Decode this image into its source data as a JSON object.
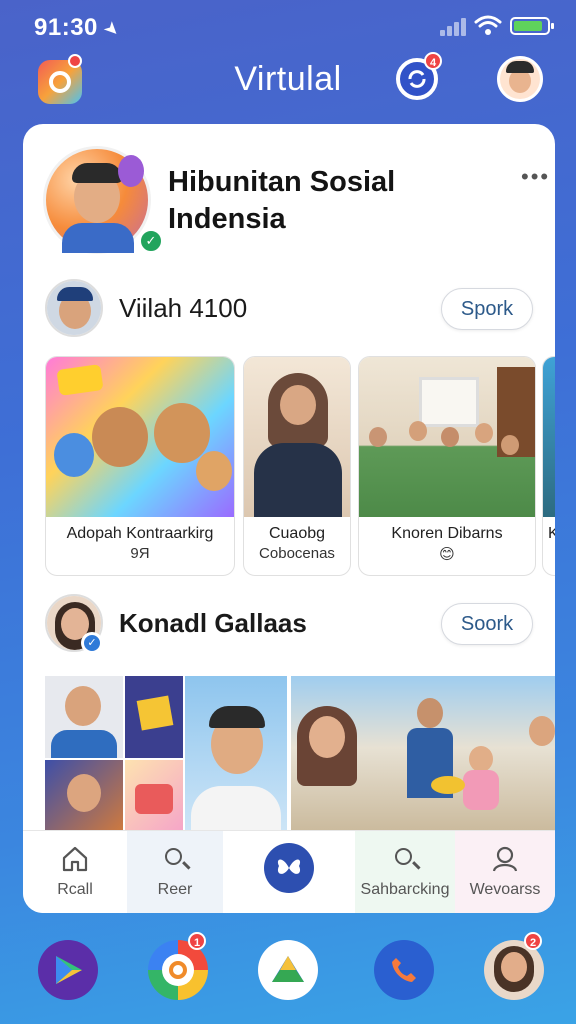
{
  "status_bar": {
    "time": "91:30"
  },
  "header": {
    "title": "Virtulal",
    "camera_badge": "",
    "messages_badge": "4"
  },
  "group": {
    "title": "Hibunitan Sosial Indensia"
  },
  "rows": [
    {
      "name": "Viilah 4100",
      "button": "Spork"
    },
    {
      "name": "Konadl Gallaas",
      "button": "Soork"
    }
  ],
  "carousel": [
    {
      "caption": "Adopah Kontraarkirg",
      "sub": "9Я"
    },
    {
      "caption": "Cuaobg",
      "sub": "Cobocenas"
    },
    {
      "caption": "Knoren Dibarns",
      "sub": ""
    },
    {
      "caption": "K",
      "sub": ""
    }
  ],
  "bottom_nav": [
    {
      "label": "Rcall",
      "icon": "home-icon"
    },
    {
      "label": "Reer",
      "icon": "search-icon"
    },
    {
      "label": "",
      "icon": "butterfly-icon"
    },
    {
      "label": "Sahbarcking",
      "icon": "search-icon"
    },
    {
      "label": "Wevoarss",
      "icon": "person-icon"
    }
  ],
  "dock": {
    "q_badge": "1",
    "contact_badge": "2"
  },
  "colors": {
    "background_top": "#4a63c9",
    "background_bottom": "#3aa3e6",
    "accent": "#2d4fb0",
    "verified": "#22a45d",
    "badge": "#ef4444"
  }
}
